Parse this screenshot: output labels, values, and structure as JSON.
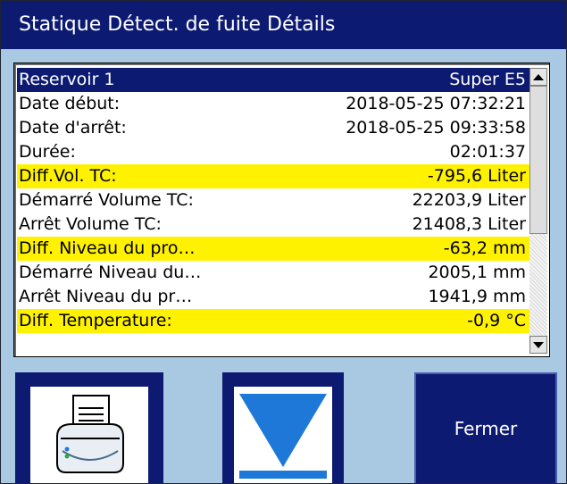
{
  "window": {
    "title": "Statique Détect. de fuite Détails"
  },
  "details": {
    "header": {
      "label": "Reservoir 1",
      "value": "Super E5"
    },
    "rows": [
      {
        "label": "Date début:",
        "value": "2018-05-25 07:32:21",
        "highlight": false
      },
      {
        "label": "Date d'arrêt:",
        "value": "2018-05-25 09:33:58",
        "highlight": false
      },
      {
        "label": "Durée:",
        "value": "02:01:37",
        "highlight": false
      },
      {
        "label": "Diff.Vol. TC:",
        "value": "-795,6 Liter",
        "highlight": true
      },
      {
        "label": "Démarré Volume TC:",
        "value": "22203,9 Liter",
        "highlight": false
      },
      {
        "label": "Arrêt Volume TC:",
        "value": "21408,3 Liter",
        "highlight": false
      },
      {
        "label": "Diff. Niveau du pro…",
        "value": "-63,2 mm",
        "highlight": true
      },
      {
        "label": "Démarré Niveau du…",
        "value": "2005,1 mm",
        "highlight": false
      },
      {
        "label": "Arrêt Niveau du pr…",
        "value": "1941,9 mm",
        "highlight": false
      },
      {
        "label": "Diff. Temperature:",
        "value": "-0,9 °C",
        "highlight": true
      }
    ]
  },
  "buttons": {
    "print_icon": "printer-icon",
    "download_icon": "arrow-down-to-line-icon",
    "close_label": "Fermer"
  },
  "colors": {
    "title_bar": "#0d1a72",
    "background": "#a9c8e2",
    "highlight": "#fff200",
    "icon_blue": "#1e78d8"
  }
}
